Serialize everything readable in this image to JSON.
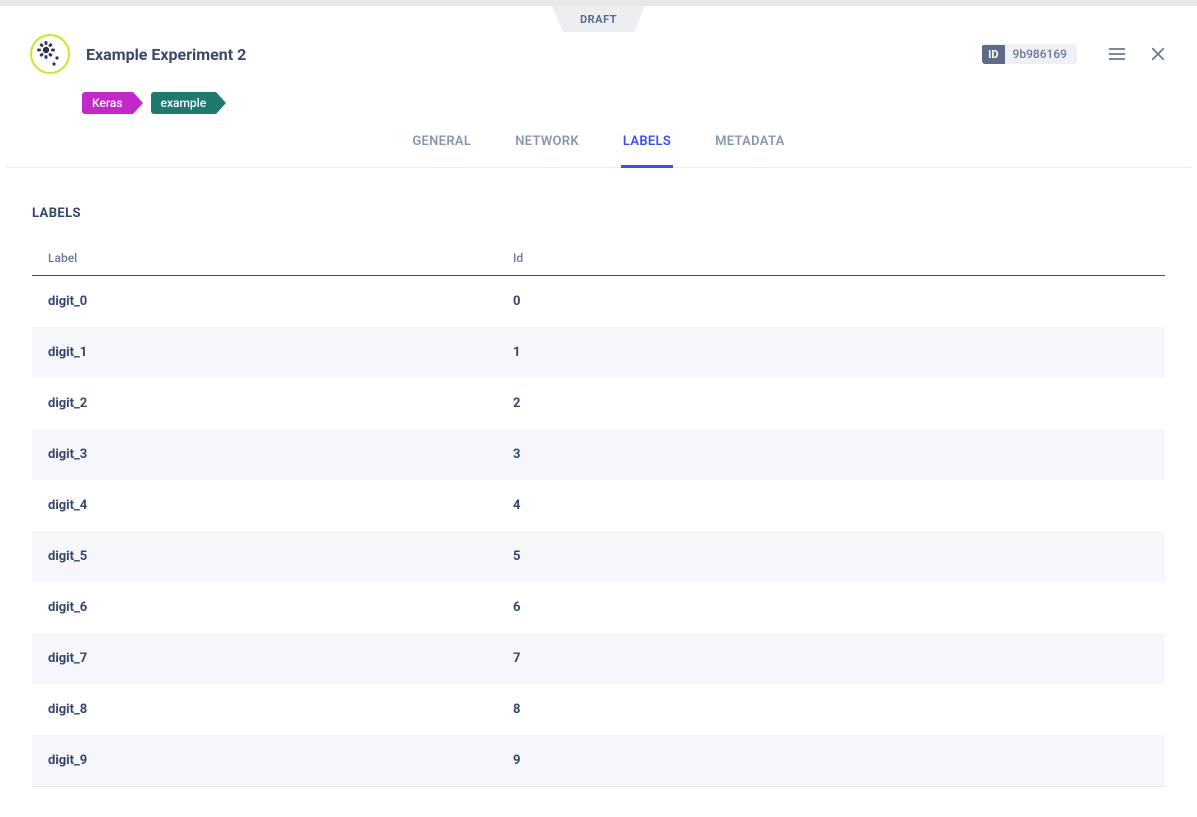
{
  "draft_label": "DRAFT",
  "experiment": {
    "title": "Example Experiment 2",
    "id_label": "ID",
    "id_value": "9b986169"
  },
  "tags": [
    {
      "name": "Keras",
      "cls": "tag-keras"
    },
    {
      "name": "example",
      "cls": "tag-example"
    }
  ],
  "tabs": [
    {
      "label": "GENERAL",
      "active": false
    },
    {
      "label": "NETWORK",
      "active": false
    },
    {
      "label": "LABELS",
      "active": true
    },
    {
      "label": "METADATA",
      "active": false
    }
  ],
  "section_title": "LABELS",
  "columns": {
    "label": "Label",
    "id": "Id"
  },
  "rows": [
    {
      "label": "digit_0",
      "id": "0"
    },
    {
      "label": "digit_1",
      "id": "1"
    },
    {
      "label": "digit_2",
      "id": "2"
    },
    {
      "label": "digit_3",
      "id": "3"
    },
    {
      "label": "digit_4",
      "id": "4"
    },
    {
      "label": "digit_5",
      "id": "5"
    },
    {
      "label": "digit_6",
      "id": "6"
    },
    {
      "label": "digit_7",
      "id": "7"
    },
    {
      "label": "digit_8",
      "id": "8"
    },
    {
      "label": "digit_9",
      "id": "9"
    }
  ]
}
